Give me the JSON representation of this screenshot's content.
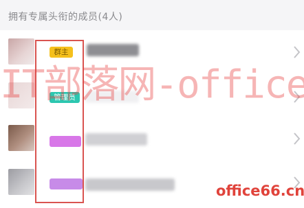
{
  "header": {
    "title": "拥有专属头衔的成员(4人)"
  },
  "members": [
    {
      "badge": "群主",
      "badge_color": "#f5c01c"
    },
    {
      "badge": "管理员",
      "badge_color": "#2cc7b0"
    },
    {
      "badge": "",
      "badge_color": "#d877e8"
    },
    {
      "badge": "",
      "badge_color": "#c78be8"
    }
  ],
  "watermark": {
    "main": "IT部落网-office教程网",
    "site": "office66.cn"
  },
  "icons": {
    "row_chevron": "chevron-right-icon"
  }
}
